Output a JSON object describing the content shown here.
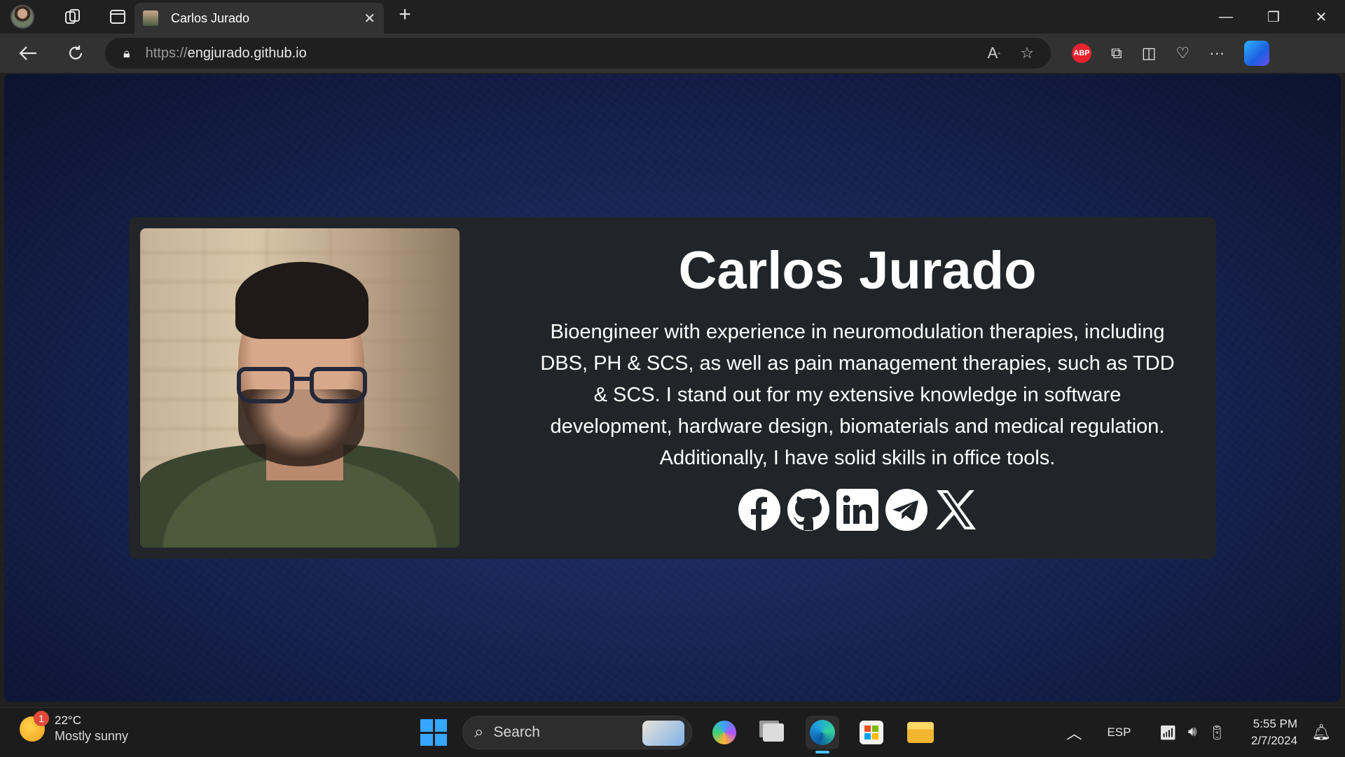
{
  "browser": {
    "tab": {
      "title": "Carlos Jurado"
    },
    "address": {
      "protocol": "https://",
      "host": "engjurado.github.io"
    },
    "toolbar": {
      "adblock_label": "ABP"
    }
  },
  "page": {
    "name": "Carlos Jurado",
    "bio": "Bioengineer with experience in neuromodulation therapies, including DBS, PH & SCS, as well as pain management therapies, such as TDD & SCS. I stand out for my extensive knowledge in software development, hardware design, biomaterials and medical regulation. Additionally, I have solid skills in office tools.",
    "socials": [
      "facebook-icon",
      "github-icon",
      "linkedin-icon",
      "telegram-icon",
      "x-icon"
    ]
  },
  "taskbar": {
    "weather": {
      "temp": "22°C",
      "condition": "Mostly sunny",
      "badge": "1"
    },
    "search_label": "Search",
    "tray": {
      "language": "ESP",
      "time": "5:55 PM",
      "date": "2/7/2024"
    }
  },
  "colors": {
    "card_bg": "#212529",
    "accent": "#4cc2ff",
    "page_bg": "#16224f"
  }
}
